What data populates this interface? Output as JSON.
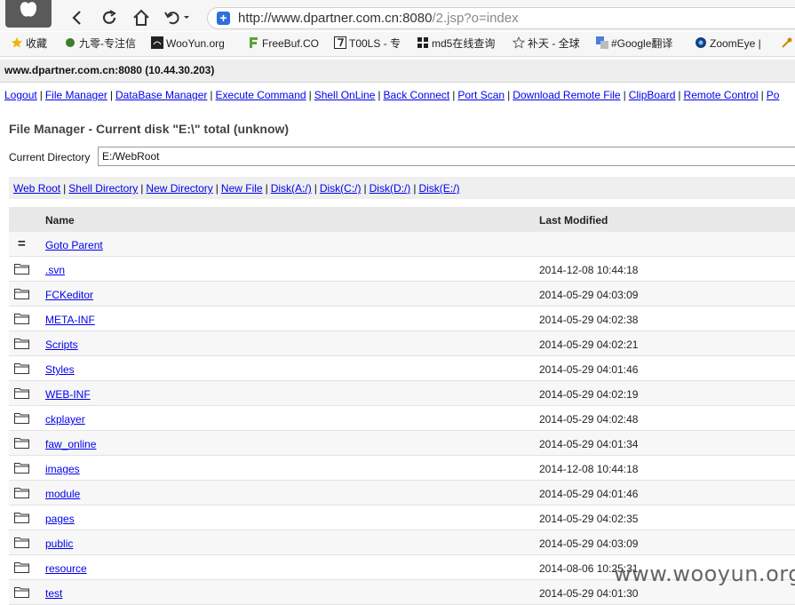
{
  "browser": {
    "url_host": "http://www.dpartner.com.cn:8080",
    "url_path": "/2.jsp?o=index",
    "bookmarks": [
      {
        "label": "收藏",
        "icon": "star-icon"
      },
      {
        "label": "九零-专注信",
        "icon": "dragon-icon"
      },
      {
        "label": "WooYun.org",
        "icon": "wooyun-icon"
      },
      {
        "label": "FreeBuf.CO",
        "icon": "freebuf-icon"
      },
      {
        "label": "T00LS - 专",
        "icon": "tools-icon"
      },
      {
        "label": "md5在线查询",
        "icon": "grid-icon"
      },
      {
        "label": "补天 - 全球",
        "icon": "butian-icon"
      },
      {
        "label": "#Google翻译",
        "icon": "translate-icon"
      },
      {
        "label": "ZoomEye |",
        "icon": "eye-icon"
      }
    ]
  },
  "page": {
    "host_line": "www.dpartner.com.cn:8080 (10.44.30.203)",
    "menu": [
      "Logout",
      "File Manager",
      "DataBase Manager",
      "Execute Command",
      "Shell OnLine",
      "Back Connect",
      "Port Scan",
      "Download Remote File",
      "ClipBoard",
      "Remote Control",
      "Po"
    ],
    "title": "File Manager - Current disk \"E:\\\" total (unknow)",
    "current_directory_label": "Current Directory",
    "current_directory_value": "E:/WebRoot",
    "quick_links": [
      "Web Root",
      "Shell Directory",
      "New Directory",
      "New File",
      "Disk(A:/)",
      "Disk(C:/)",
      "Disk(D:/)",
      "Disk(E:/)"
    ],
    "table": {
      "headers": {
        "name": "Name",
        "modified": "Last Modified"
      },
      "parent": {
        "mark": "=",
        "label": "Goto Parent"
      },
      "rows": [
        {
          "name": ".svn",
          "modified": "2014-12-08 10:44:18"
        },
        {
          "name": "FCKeditor",
          "modified": "2014-05-29 04:03:09"
        },
        {
          "name": "META-INF",
          "modified": "2014-05-29 04:02:38"
        },
        {
          "name": "Scripts",
          "modified": "2014-05-29 04:02:21"
        },
        {
          "name": "Styles",
          "modified": "2014-05-29 04:01:46"
        },
        {
          "name": "WEB-INF",
          "modified": "2014-05-29 04:02:19"
        },
        {
          "name": "ckplayer",
          "modified": "2014-05-29 04:02:48"
        },
        {
          "name": "faw_online",
          "modified": "2014-05-29 04:01:34"
        },
        {
          "name": "images",
          "modified": "2014-12-08 10:44:18"
        },
        {
          "name": "module",
          "modified": "2014-05-29 04:01:46"
        },
        {
          "name": "pages",
          "modified": "2014-05-29 04:02:35"
        },
        {
          "name": "public",
          "modified": "2014-05-29 04:03:09"
        },
        {
          "name": "resource",
          "modified": "2014-08-06 10:25:31"
        },
        {
          "name": "test",
          "modified": "2014-05-29 04:01:30"
        }
      ]
    }
  },
  "watermark": "www.wooyun.org"
}
